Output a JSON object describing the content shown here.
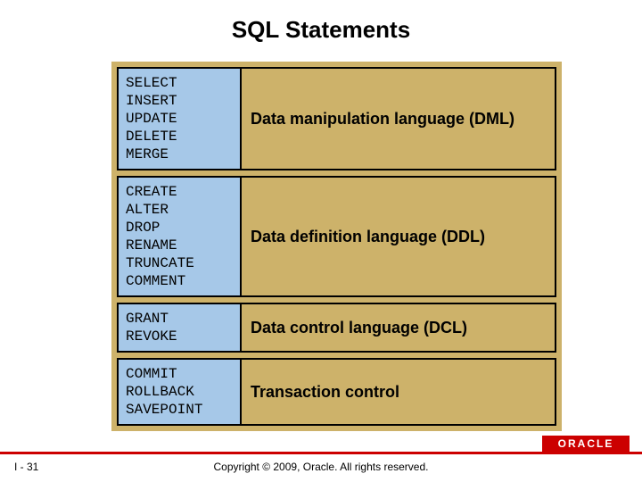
{
  "title": "SQL Statements",
  "rows": [
    {
      "commands": "SELECT\nINSERT\nUPDATE\nDELETE\nMERGE",
      "description": "Data manipulation language (DML)"
    },
    {
      "commands": "CREATE\nALTER\nDROP\nRENAME\nTRUNCATE\nCOMMENT",
      "description": "Data definition language (DDL)"
    },
    {
      "commands": "GRANT\nREVOKE",
      "description": "Data control language (DCL)"
    },
    {
      "commands": "COMMIT\nROLLBACK\nSAVEPOINT",
      "description": "Transaction control"
    }
  ],
  "footer": {
    "page": "I - 31",
    "copyright": "Copyright © 2009, Oracle. All rights reserved.",
    "logo": "ORACLE"
  }
}
